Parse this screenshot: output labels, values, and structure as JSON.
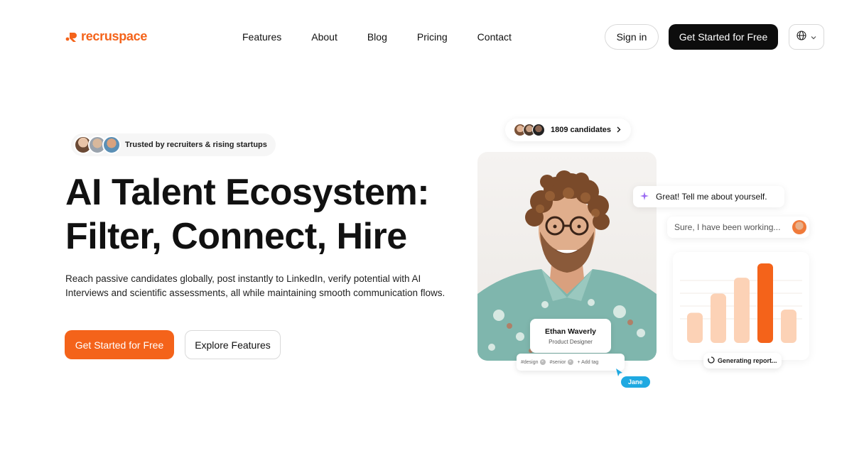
{
  "brand": {
    "name": "recruspace",
    "accent": "#f4631a"
  },
  "nav": {
    "items": [
      {
        "label": "Features"
      },
      {
        "label": "About"
      },
      {
        "label": "Blog"
      },
      {
        "label": "Pricing"
      },
      {
        "label": "Contact"
      }
    ],
    "sign_in": "Sign in",
    "cta": "Get Started for Free",
    "language_icon": "globe-icon"
  },
  "hero": {
    "trusted_text": "Trusted by recruiters & rising startups",
    "title_line1": "AI Talent Ecosystem:",
    "title_line2": "Filter, Connect, Hire",
    "subtitle": "Reach passive candidates globally, post instantly to LinkedIn, verify potential with AI Interviews and scientific assessments, all while maintaining smooth communication flows.",
    "primary_cta": "Get Started for Free",
    "secondary_cta": "Explore Features"
  },
  "showcase": {
    "candidates_label": "1809 candidates",
    "candidate_name": "Ethan Waverly",
    "candidate_role": "Product Designer",
    "tags": [
      "#design",
      "#senior"
    ],
    "add_tag_label": "+ Add tag",
    "cursor_user": "Jane",
    "chat_ai": "Great! Tell me about yourself.",
    "chat_user": "Sure, I have been working...",
    "report_status": "Generating report...",
    "chart_bars": [
      0.38,
      0.62,
      0.82,
      1.0,
      0.42
    ]
  }
}
